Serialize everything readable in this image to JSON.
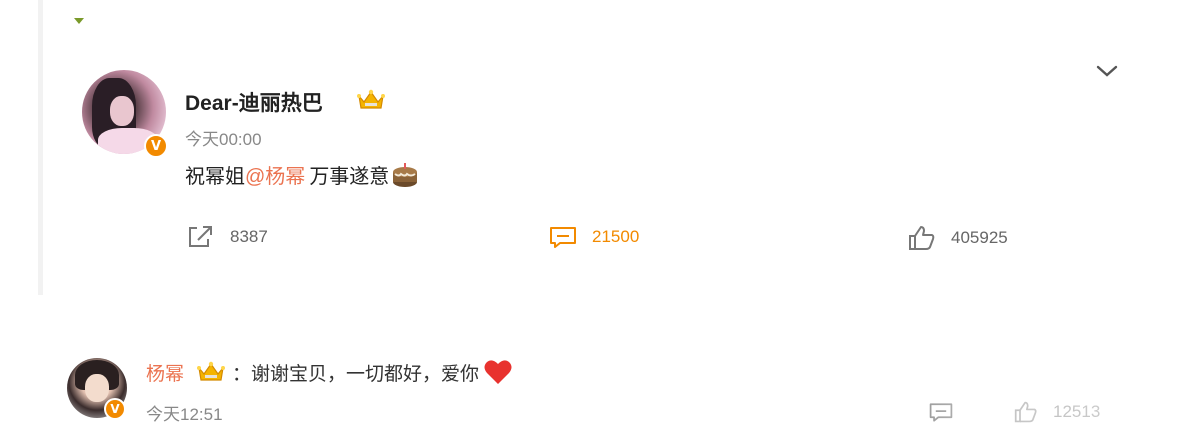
{
  "post": {
    "username": "Dear-迪丽热巴",
    "timestamp": "今天00:00",
    "content_prefix": "祝幂姐",
    "mention": "@杨幂",
    "content_suffix": " 万事遂意",
    "emoji": "cake-icon",
    "verified_badge": "V",
    "accent_color": "#f28a00",
    "mention_color": "#eb7350",
    "actions": {
      "repost_count": "8387",
      "comment_count": "21500",
      "like_count": "405925"
    }
  },
  "reply": {
    "username": "杨幂",
    "text": "：谢谢宝贝，一切都好，爱你",
    "timestamp": "今天12:51",
    "verified_badge": "V",
    "like_count": "12513"
  }
}
